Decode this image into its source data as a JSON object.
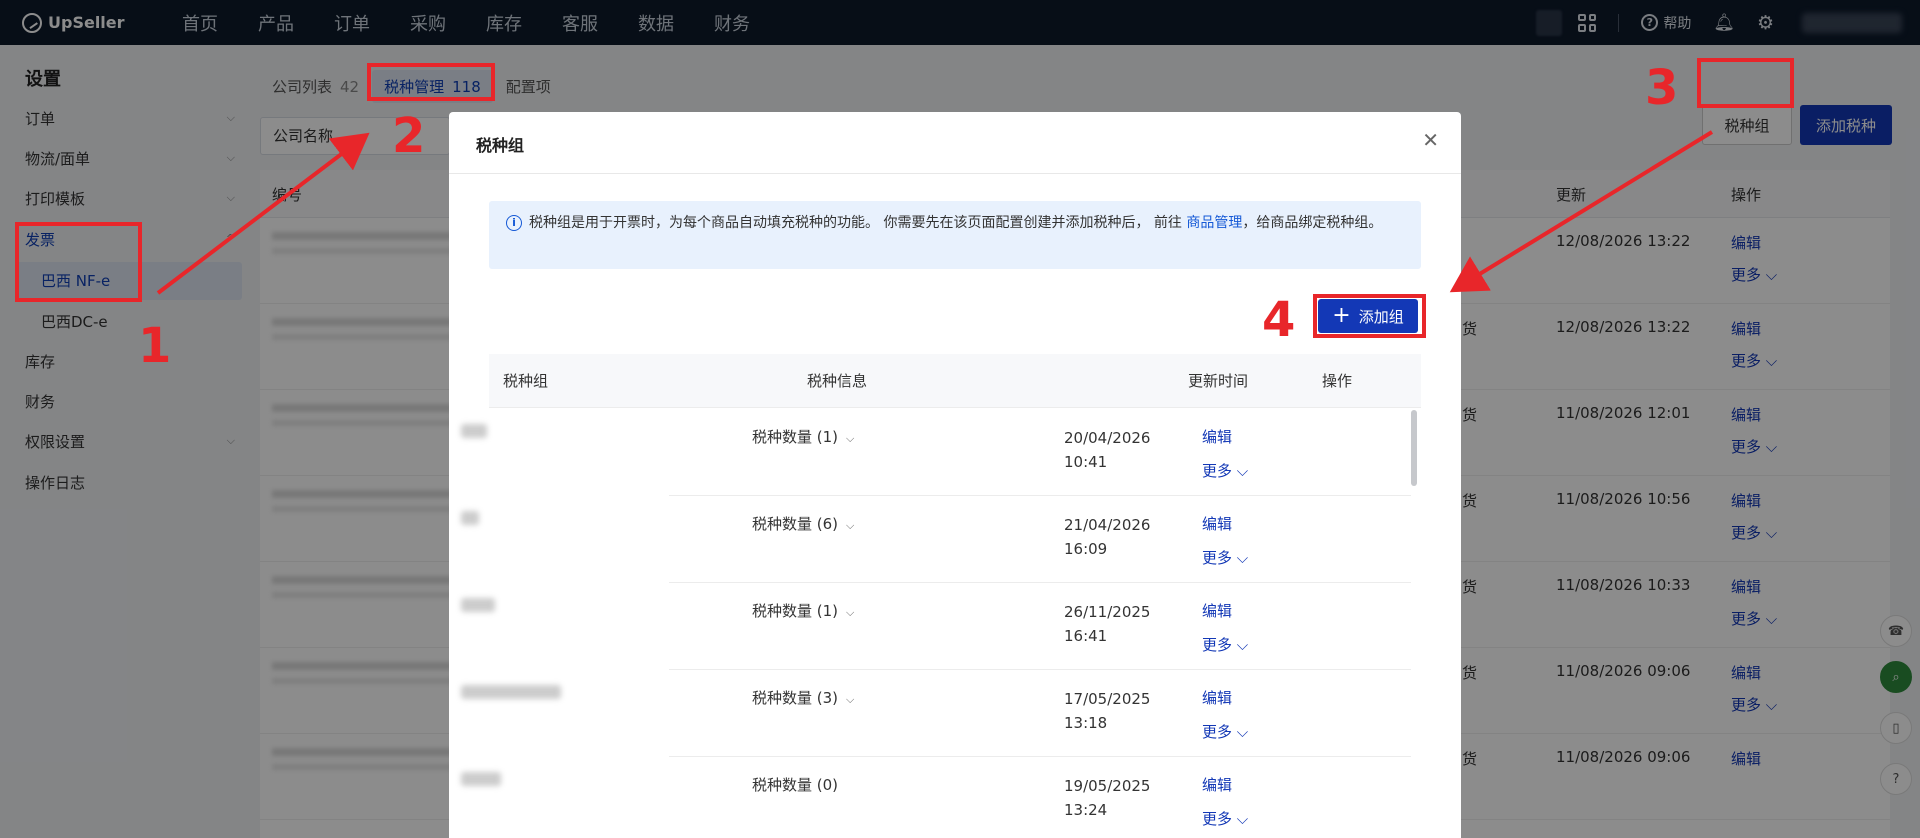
{
  "app": {
    "logo": "UpSeller"
  },
  "nav": [
    "首页",
    "产品",
    "订单",
    "采购",
    "库存",
    "客服",
    "数据",
    "财务"
  ],
  "header": {
    "help": "帮助"
  },
  "sidebar": {
    "title": "设置",
    "items": [
      {
        "label": "订单"
      },
      {
        "label": "物流/面单"
      },
      {
        "label": "打印模板"
      },
      {
        "label": "发票"
      },
      {
        "label": "巴西 NF-e"
      },
      {
        "label": "巴西DC-e"
      },
      {
        "label": "库存"
      },
      {
        "label": "财务"
      },
      {
        "label": "权限设置"
      },
      {
        "label": "操作日志"
      }
    ]
  },
  "tabs": [
    {
      "label": "公司列表",
      "count": "42"
    },
    {
      "label": "税种管理",
      "count": "118"
    },
    {
      "label": "配置项",
      "count": ""
    }
  ],
  "filter": {
    "label": "公司名称"
  },
  "actions": {
    "tax_group": "税种组",
    "add_tax": "添加税种"
  },
  "bg_table": {
    "headers": {
      "col1": "编号",
      "update": "更新",
      "ops": "操作"
    },
    "rows": [
      {
        "huo": "",
        "date": "12/08/2026 13:22",
        "edit": "编辑",
        "more": "更多"
      },
      {
        "huo": "货",
        "date": "12/08/2026 13:22",
        "edit": "编辑",
        "more": "更多"
      },
      {
        "huo": "货",
        "date": "11/08/2026 12:01",
        "edit": "编辑",
        "more": "更多"
      },
      {
        "huo": "货",
        "date": "11/08/2026 10:56",
        "edit": "编辑",
        "more": "更多"
      },
      {
        "huo": "货",
        "date": "11/08/2026 10:33",
        "edit": "编辑",
        "more": "更多"
      },
      {
        "huo": "货",
        "date": "11/08/2026 09:06",
        "edit": "编辑",
        "more": "更多"
      },
      {
        "huo": "货",
        "date": "11/08/2026 09:06",
        "edit": "编辑",
        "more": ""
      }
    ]
  },
  "modal": {
    "title": "税种组",
    "info_text": "税种组是用于开票时，为每个商品自动填充税种的功能。 你需要先在该页面配置创建并添加税种后， 前往 ",
    "info_link": "商品管理",
    "info_tail": "，给商品绑定税种组。",
    "add_group": "添加组",
    "columns": {
      "group": "税种组",
      "info": "税种信息",
      "time": "更新时间",
      "ops": "操作"
    },
    "rows": [
      {
        "info": "税种数量 (1)",
        "expandable": true,
        "date": "20/04/2026",
        "time": "10:41",
        "edit": "编辑",
        "more": "更多"
      },
      {
        "info": "税种数量 (6)",
        "expandable": true,
        "date": "21/04/2026",
        "time": "16:09",
        "edit": "编辑",
        "more": "更多"
      },
      {
        "info": "税种数量 (1)",
        "expandable": true,
        "date": "26/11/2025",
        "time": "16:41",
        "edit": "编辑",
        "more": "更多"
      },
      {
        "info": "税种数量 (3)",
        "expandable": true,
        "date": "17/05/2025",
        "time": "13:18",
        "edit": "编辑",
        "more": "更多"
      },
      {
        "info": "税种数量 (0)",
        "expandable": false,
        "date": "19/05/2025",
        "time": "13:24",
        "edit": "编辑",
        "more": "更多"
      }
    ]
  },
  "annotations": {
    "n1": "1",
    "n2": "2",
    "n3": "3",
    "n4": "4",
    "color": "#e8262a"
  }
}
